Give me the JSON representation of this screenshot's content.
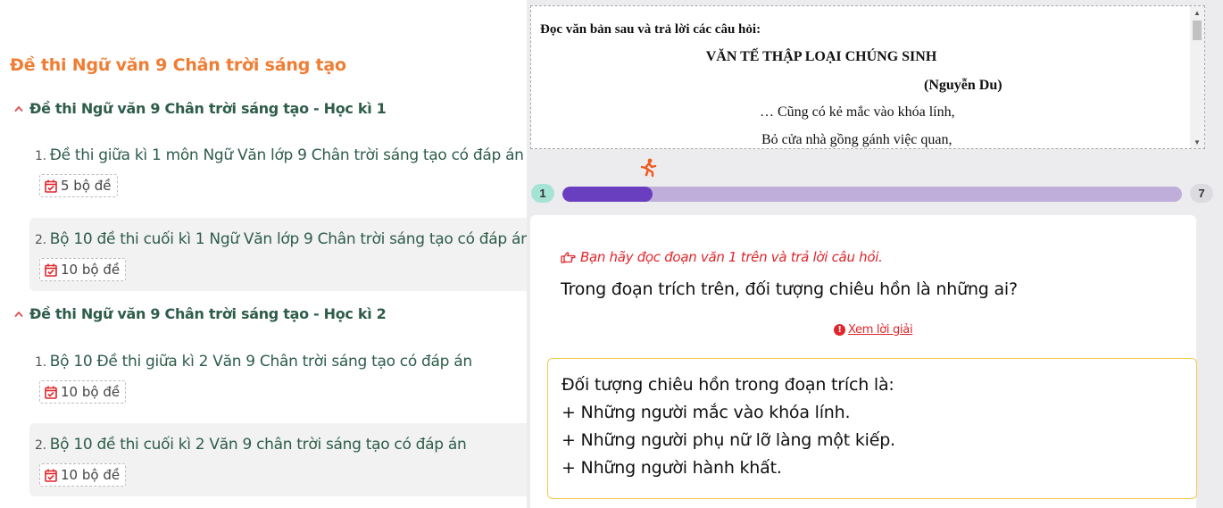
{
  "left": {
    "title": "Đề thi Ngữ văn 9 Chân trời sáng tạo",
    "sections": [
      {
        "heading": "Đề thi Ngữ văn 9 Chân trời sáng tạo - Học kì 1",
        "items": [
          {
            "num": "1.",
            "title": "Đề thi giữa kì 1 môn Ngữ Văn lớp 9 Chân trời sáng tạo có đáp án",
            "count": "5 bộ đề"
          },
          {
            "num": "2.",
            "title": "Bộ 10 đề thi cuối kì 1 Ngữ Văn lớp 9 Chân trời sáng tạo có đáp án",
            "count": "10 bộ đề"
          }
        ]
      },
      {
        "heading": "Đề thi Ngữ văn 9 Chân trời sáng tạo - Học kì 2",
        "items": [
          {
            "num": "1.",
            "title": "Bộ 10 Đề thi giữa kì 2 Văn 9 Chân trời sáng tạo có đáp án",
            "count": "10 bộ đề"
          },
          {
            "num": "2.",
            "title": "Bộ 10 đề thi cuối kì 2 Văn 9 chân trời sáng tạo có đáp án",
            "count": "10 bộ đề"
          }
        ]
      }
    ]
  },
  "passage": {
    "intro": "Đọc văn bản sau và trả lời các câu hỏi:",
    "title": "VĂN TẾ THẬP LOẠI CHÚNG SINH",
    "author": "(Nguyễn Du)",
    "line1": "… Cũng có kẻ mắc vào khóa lính,",
    "line2": "Bỏ cửa nhà gồng gánh việc quan,"
  },
  "progress": {
    "start": "1",
    "end": "7",
    "current_fraction": 0.145
  },
  "question_card": {
    "hint": "Bạn hãy đọc đoạn văn 1 trên và trả lời câu hỏi.",
    "question": "Trong đoạn trích trên, đối tượng chiêu hồn là những ai?",
    "view_solution": "Xem lời giải",
    "answer_lines": [
      "Đối tượng chiêu hồn trong đoạn trích là:",
      "+ Những người mắc vào khóa lính.",
      "+ Những người phụ nữ lỡ làng một kiếp.",
      "+ Những người hành khất."
    ]
  },
  "colors": {
    "title_orange": "#ef7d33",
    "heading_green": "#2e5d4a",
    "accent_red": "#e0262b",
    "progress_fill": "#6a3fbf",
    "progress_track": "#bfaed9",
    "answer_border": "#f2c94c"
  }
}
